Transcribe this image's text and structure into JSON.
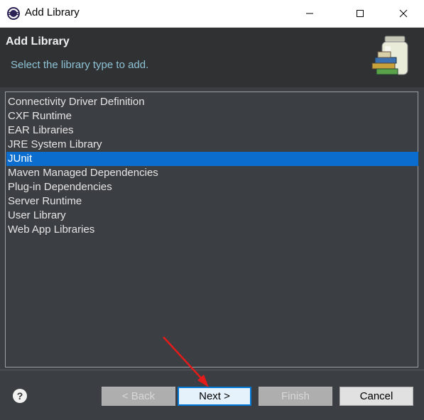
{
  "window": {
    "title": "Add Library",
    "icon": "eclipse-icon",
    "controls": [
      "minimize-icon",
      "maximize-icon",
      "close-icon"
    ]
  },
  "header": {
    "title": "Add Library",
    "description": "Select the library type to add.",
    "icon": "library-books-icon"
  },
  "library_types": [
    {
      "label": "Connectivity Driver Definition",
      "selected": false
    },
    {
      "label": "CXF Runtime",
      "selected": false
    },
    {
      "label": "EAR Libraries",
      "selected": false
    },
    {
      "label": "JRE System Library",
      "selected": false
    },
    {
      "label": "JUnit",
      "selected": true
    },
    {
      "label": "Maven Managed Dependencies",
      "selected": false
    },
    {
      "label": "Plug-in Dependencies",
      "selected": false
    },
    {
      "label": "Server Runtime",
      "selected": false
    },
    {
      "label": "User Library",
      "selected": false
    },
    {
      "label": "Web App Libraries",
      "selected": false
    }
  ],
  "footer": {
    "help": "?",
    "back_label": "< Back",
    "next_label": "Next >",
    "finish_label": "Finish",
    "cancel_label": "Cancel"
  },
  "colors": {
    "selection": "#0b6ecf",
    "annotation_arrow": "#e31b1b"
  }
}
